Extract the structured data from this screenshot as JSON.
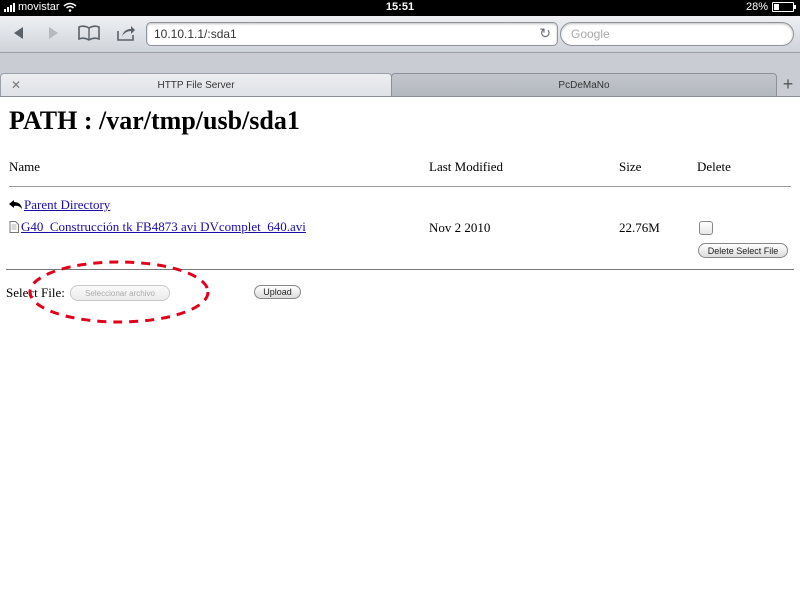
{
  "status_bar": {
    "carrier": "movistar",
    "time": "15:51",
    "battery": "28%",
    "battery_level": 0.28
  },
  "toolbar": {
    "back_icon": "back-arrow-icon",
    "forward_icon": "forward-arrow-icon",
    "bookmarks_icon": "book-icon",
    "share_icon": "share-icon",
    "url": "10.10.1.1/:sda1",
    "reload_icon": "reload-icon",
    "search_placeholder": "Google"
  },
  "tabs": [
    {
      "label": "HTTP File Server",
      "active": true
    },
    {
      "label": "PcDeMaNo",
      "active": false
    }
  ],
  "page": {
    "title": "PATH : /var/tmp/usb/sda1",
    "columns": {
      "name": "Name",
      "modified": "Last Modified",
      "size": "Size",
      "delete": "Delete"
    },
    "parent_link": "Parent Directory",
    "files": [
      {
        "name": "G40_Construcción tk FB4873 avi DVcomplet_640.avi",
        "modified": "Nov 2 2010",
        "size": "22.76M",
        "checked": false
      }
    ],
    "delete_button": "Delete Select File",
    "select_file_label": "Select File:",
    "file_chooser_label": "Seleccionar archivo",
    "upload_button": "Upload"
  },
  "colors": {
    "link": "#1a0dab",
    "annotation": "#e0001b"
  }
}
